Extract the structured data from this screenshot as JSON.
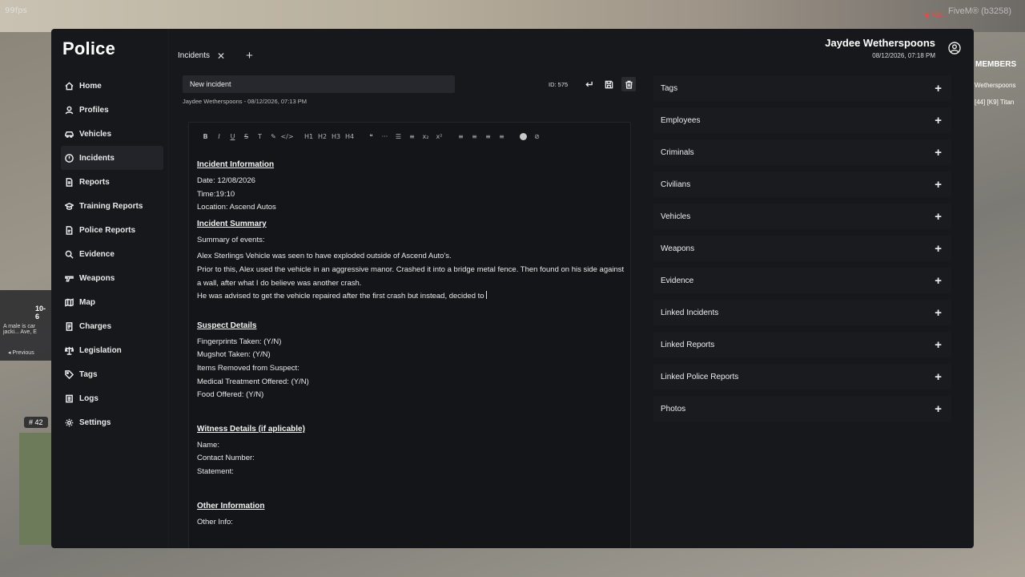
{
  "overlay": {
    "fps": "99fps",
    "rec": "● REC",
    "fivem": "FiveM® (b3258)",
    "members": "MEMBERS",
    "member_1": "Wetherspoons",
    "member_2": "[44] [K9] Titan",
    "dispatch_code": "10-6",
    "dispatch_text": "A male is car jacki... Ave, E",
    "dispatch_prev": "◂ Previous",
    "unit_badge": "# 42"
  },
  "app": {
    "title": "Police"
  },
  "sidebar": {
    "items": [
      {
        "label": "Home",
        "icon": "home-icon"
      },
      {
        "label": "Profiles",
        "icon": "user-icon"
      },
      {
        "label": "Vehicles",
        "icon": "car-icon"
      },
      {
        "label": "Incidents",
        "icon": "alert-icon",
        "active": true
      },
      {
        "label": "Reports",
        "icon": "file-icon"
      },
      {
        "label": "Training Reports",
        "icon": "graduation-icon"
      },
      {
        "label": "Police Reports",
        "icon": "police-file-icon"
      },
      {
        "label": "Evidence",
        "icon": "magnifier-icon"
      },
      {
        "label": "Weapons",
        "icon": "gun-icon"
      },
      {
        "label": "Map",
        "icon": "map-icon"
      },
      {
        "label": "Charges",
        "icon": "document-icon"
      },
      {
        "label": "Legislation",
        "icon": "scale-icon"
      },
      {
        "label": "Tags",
        "icon": "tag-icon"
      },
      {
        "label": "Logs",
        "icon": "log-icon"
      },
      {
        "label": "Settings",
        "icon": "gear-icon"
      }
    ]
  },
  "tabs": [
    {
      "label": "Incidents",
      "close": "✕"
    }
  ],
  "tab_add": "+",
  "user": {
    "name": "Jaydee Wetherspoons",
    "datetime": "08/12/2026, 07:18 PM"
  },
  "incident": {
    "title_value": "New incident",
    "meta": "Jaydee Wetherspoons - 08/12/2026, 07:13 PM",
    "id_label": "ID: 575"
  },
  "toolbar": [
    "B",
    "I",
    "U",
    "S",
    "T",
    "✎",
    "</>",
    "H1",
    "H2",
    "H3",
    "H4",
    "❝",
    "···",
    "☰",
    "≡",
    "x₂",
    "x²",
    "≡",
    "≡",
    "≡",
    "≡"
  ],
  "document": {
    "h_info": "Incident Information",
    "date": "Date: 12/08/2026",
    "time": "Time:19:10",
    "location": "Location: Ascend Autos",
    "h_summary": "Incident Summary",
    "summary_label": "Summary of events:",
    "line1": "Alex Sterlings Vehicle was seen to have exploded outside of Ascend Auto's.",
    "line2": "Prior to this, Alex used the vehicle in an aggressive manor. Crashed it into a bridge metal fence. Then found on his side against a wall, after what I do believe was another crash.",
    "line3": "He was advised to get the vehicle repaired after the first crash but instead, decided to",
    "h_suspect": "Suspect Details",
    "fingerprints": "Fingerprints Taken: (Y/N)",
    "mugshot": "Mugshot Taken: (Y/N)",
    "items_removed": "Items Removed from Suspect:",
    "medical": "Medical Treatment Offered: (Y/N)",
    "food": "Food Offered: (Y/N)",
    "h_witness": "Witness Details (if aplicable)",
    "name": "Name:",
    "contact": "Contact Number:",
    "statement": "Statement:",
    "h_other": "Other Information",
    "other_info": "Other Info:"
  },
  "right_panel": {
    "sections": [
      "Tags",
      "Employees",
      "Criminals",
      "Civilians",
      "Vehicles",
      "Weapons",
      "Evidence",
      "Linked Incidents",
      "Linked Reports",
      "Linked Police Reports",
      "Photos"
    ],
    "add_symbol": "+"
  }
}
